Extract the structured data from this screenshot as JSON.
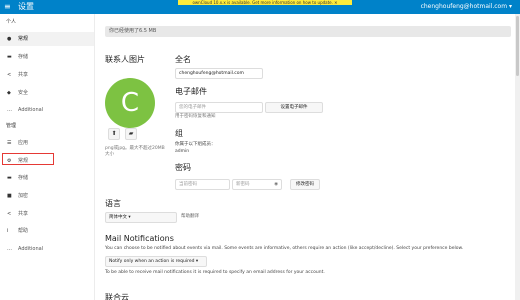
{
  "header": {
    "menu_icon": "hamburger-menu-icon",
    "title": "设置",
    "notice": "ownCloud 10.x.x is available. Get more information on how to update. ✕",
    "user": "chenghoufeng@hotmail.com ▾"
  },
  "sidebar": {
    "personal_title": "个人",
    "personal_items": [
      {
        "icon": "user-icon",
        "label": "常规",
        "active": true
      },
      {
        "icon": "storage-icon",
        "label": "存储"
      },
      {
        "icon": "share-icon",
        "label": "共享"
      },
      {
        "icon": "shield-icon",
        "label": "安全"
      },
      {
        "icon": "more-icon",
        "label": "Additional"
      }
    ],
    "admin_title": "管理",
    "admin_items": [
      {
        "icon": "list-icon",
        "label": "应用"
      },
      {
        "icon": "gear-icon",
        "label": "常规"
      },
      {
        "icon": "storage-icon",
        "label": "存储"
      },
      {
        "icon": "lock-icon",
        "label": "加密"
      },
      {
        "icon": "share-icon",
        "label": "共享"
      },
      {
        "icon": "info-icon",
        "label": "帮助"
      },
      {
        "icon": "more-icon",
        "label": "Additional"
      }
    ]
  },
  "main": {
    "quota": "你已经使用了6.5 MB",
    "avatar": {
      "title": "联系人图片",
      "letter": "C",
      "upload_icon": "upload-icon",
      "folder_icon": "folder-icon",
      "hint": "png或jpg。最大不超过20MB大小"
    },
    "fullname": {
      "title": "全名",
      "value": "chenghoufeng@hotmail.com"
    },
    "email": {
      "title": "电子邮件",
      "value": "您的电子邮件",
      "button": "设置电子邮件",
      "hint": "用于密码恢复和通知"
    },
    "groups": {
      "title": "组",
      "text": "你属于以下组成员：",
      "value": "admin"
    },
    "password": {
      "title": "密码",
      "current_placeholder": "当前密码",
      "new_placeholder": "新密码",
      "eye_icon": "eye-icon",
      "button": "修改密码"
    },
    "language": {
      "title": "语言",
      "value": "简体中文 ▾",
      "link": "帮助翻译"
    },
    "mail": {
      "title": "Mail Notifications",
      "description": "You can choose to be notified about events via mail. Some events are informative, others require an action (like accept/decline). Select your preference below.",
      "select": "Notify only when an action is required ▾",
      "note": "To be able to receive mail notifications it is required to specify an email address for your account."
    },
    "federated_title": "联合云"
  }
}
